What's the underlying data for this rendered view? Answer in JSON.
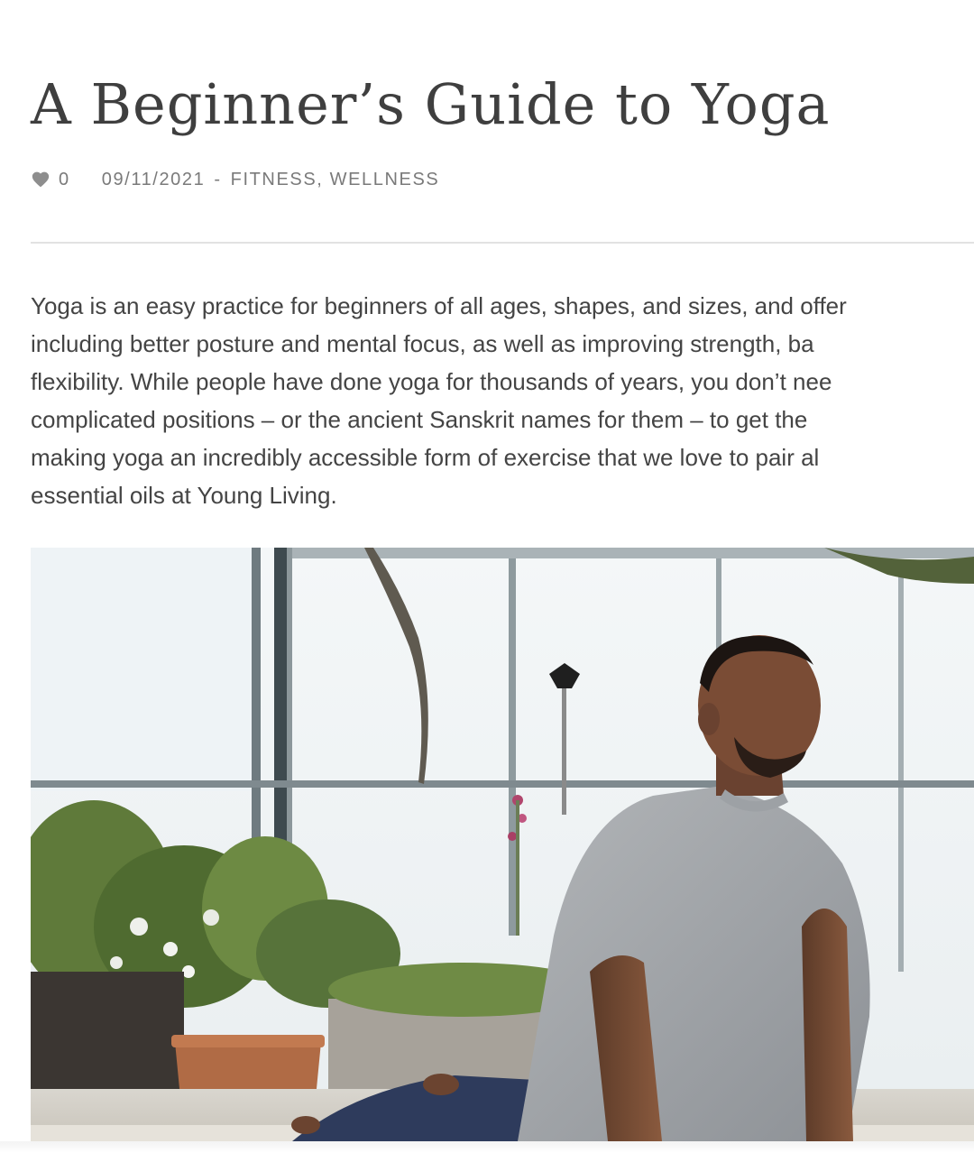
{
  "article": {
    "title": "A Beginner’s Guide to Yoga",
    "likes": "0",
    "date": "09/11/2021",
    "separator": "-",
    "categories": [
      "FITNESS",
      "WELLNESS"
    ],
    "intro_lines": [
      "Yoga is an easy practice for beginners of all ages, shapes, and sizes, and offer",
      "including better posture and mental focus, as well as improving strength, ba",
      "flexibility. While people have done yoga for thousands of years, you don’t nee",
      "complicated positions – or the ancient Sanskrit names for them – to get the",
      "making yoga an incredibly accessible form of exercise that we love to pair al",
      "essential oils at Young Living."
    ]
  },
  "icons": {
    "like": "heart-icon"
  },
  "colors": {
    "title": "#3f3f3f",
    "meta": "#7a7a7a",
    "body_text": "#444444",
    "divider": "#e2e2e2"
  }
}
